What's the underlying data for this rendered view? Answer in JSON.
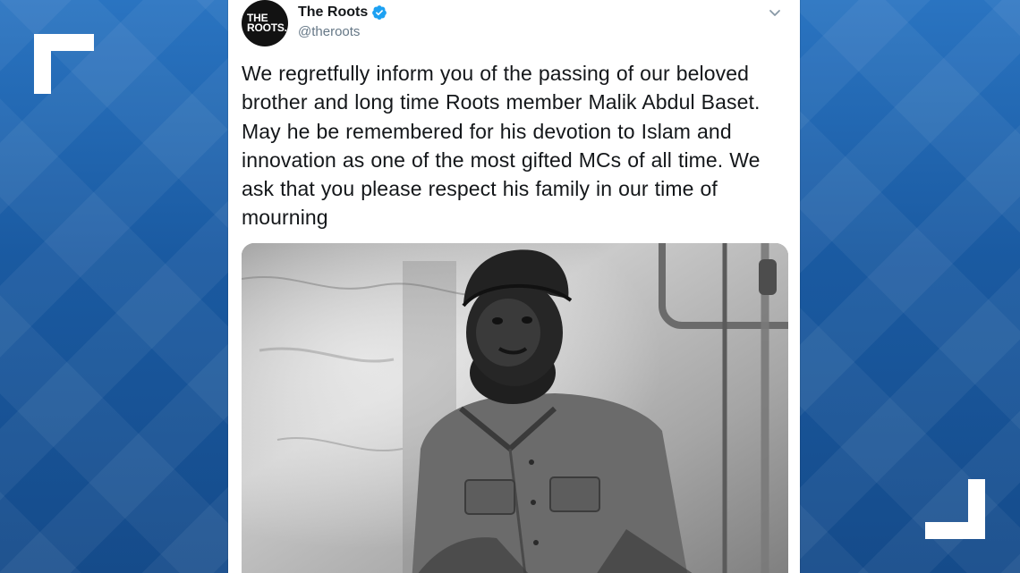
{
  "tweet": {
    "avatar_text": "THE\nROOTS.",
    "display_name": "The Roots",
    "handle": "@theroots",
    "verified_icon": "verified-badge-icon",
    "menu_icon": "chevron-down-icon",
    "text": "We regretfully inform you of the passing of our beloved brother and long time Roots member Malik Abdul Baset. May he be remembered for his devotion to Islam and innovation as one of the most gifted MCs of all time. We ask that you please respect his family in our time of mourning",
    "media_description_icon": "photo-image"
  },
  "colors": {
    "background": "#1b5fa6",
    "card": "#ffffff",
    "verified": "#1da1f2",
    "text": "#14171a",
    "handle": "#657786"
  }
}
